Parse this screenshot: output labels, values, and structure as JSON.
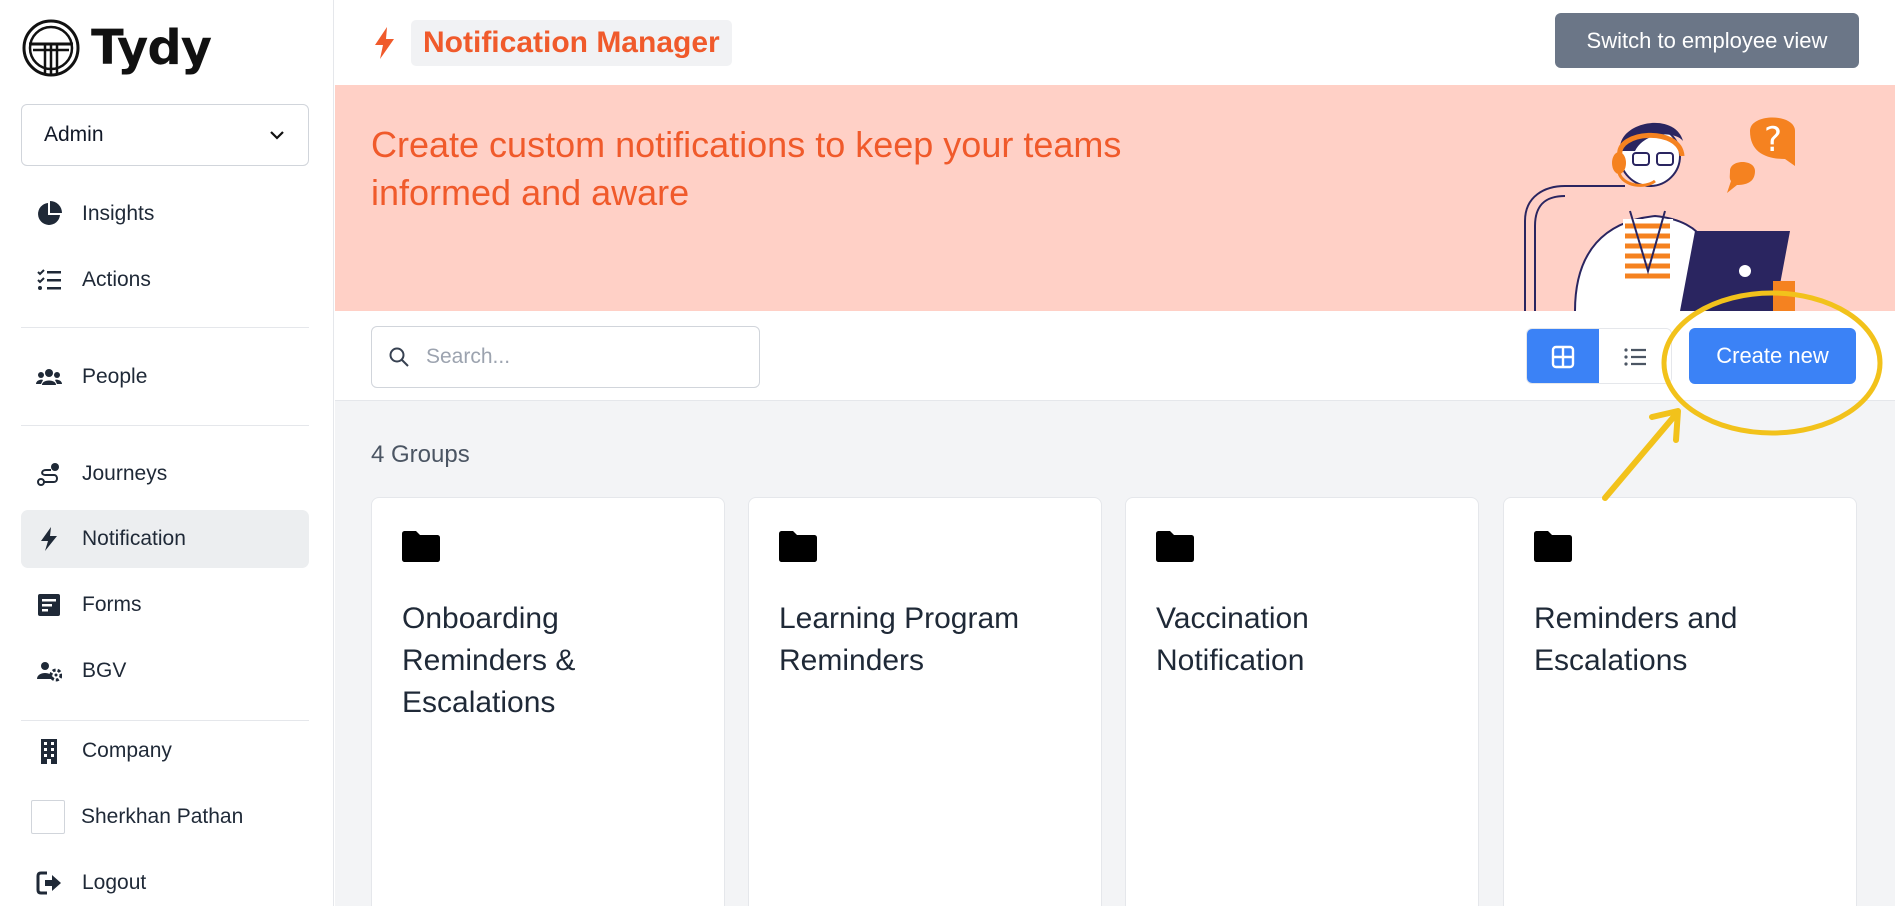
{
  "brand": {
    "name": "Tydy"
  },
  "role_select": {
    "value": "Admin"
  },
  "sidebar": {
    "items": [
      {
        "label": "Insights",
        "icon": "pie-chart-icon"
      },
      {
        "label": "Actions",
        "icon": "checklist-icon"
      },
      {
        "label": "People",
        "icon": "people-icon"
      },
      {
        "label": "Journeys",
        "icon": "route-icon"
      },
      {
        "label": "Notification",
        "icon": "bolt-icon",
        "active": true
      },
      {
        "label": "Forms",
        "icon": "form-icon"
      },
      {
        "label": "BGV",
        "icon": "users-gear-icon"
      },
      {
        "label": "Company",
        "icon": "building-icon"
      },
      {
        "label": "Sherkhan Pathan",
        "icon": "avatar"
      },
      {
        "label": "Logout",
        "icon": "logout-icon"
      }
    ]
  },
  "header": {
    "title": "Notification Manager",
    "switch_button": "Switch to employee view"
  },
  "banner": {
    "text": "Create custom notifications to keep your teams informed and aware"
  },
  "toolbar": {
    "search_placeholder": "Search...",
    "create_button": "Create new"
  },
  "content": {
    "group_count": "4 Groups",
    "groups": [
      {
        "title": "Onboarding Reminders & Escalations"
      },
      {
        "title": "Learning Program Reminders"
      },
      {
        "title": "Vaccination Notification"
      },
      {
        "title": "Reminders and Escalations"
      }
    ]
  },
  "colors": {
    "accent": "#f05a2b",
    "primary": "#3b82f6",
    "banner_bg": "#ffd0c6",
    "switch_bg": "#6b7687",
    "annotation": "#f2c21b"
  }
}
